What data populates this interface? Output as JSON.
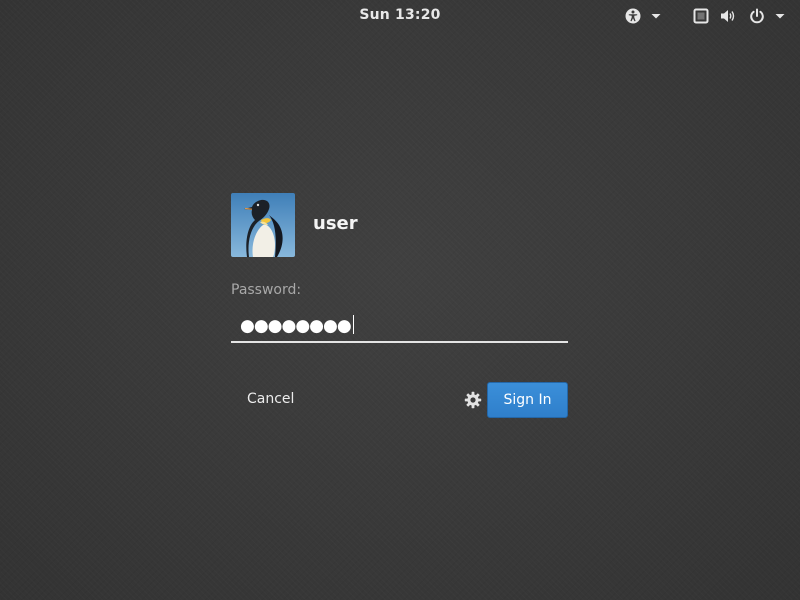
{
  "top_bar": {
    "clock": "Sun 13:20",
    "icons": [
      "accessibility-icon",
      "chevron-down-icon",
      "display-icon",
      "volume-icon",
      "power-icon",
      "chevron-down-icon"
    ]
  },
  "login": {
    "username": "user",
    "password_label": "Password:",
    "password_mask": "●●●●●●●●",
    "cancel_label": "Cancel",
    "session_icon": "gear-icon",
    "signin_label": "Sign In"
  },
  "colors": {
    "background": "#3b3b3b",
    "accent": "#3584d4",
    "label": "#a8a8a8"
  }
}
